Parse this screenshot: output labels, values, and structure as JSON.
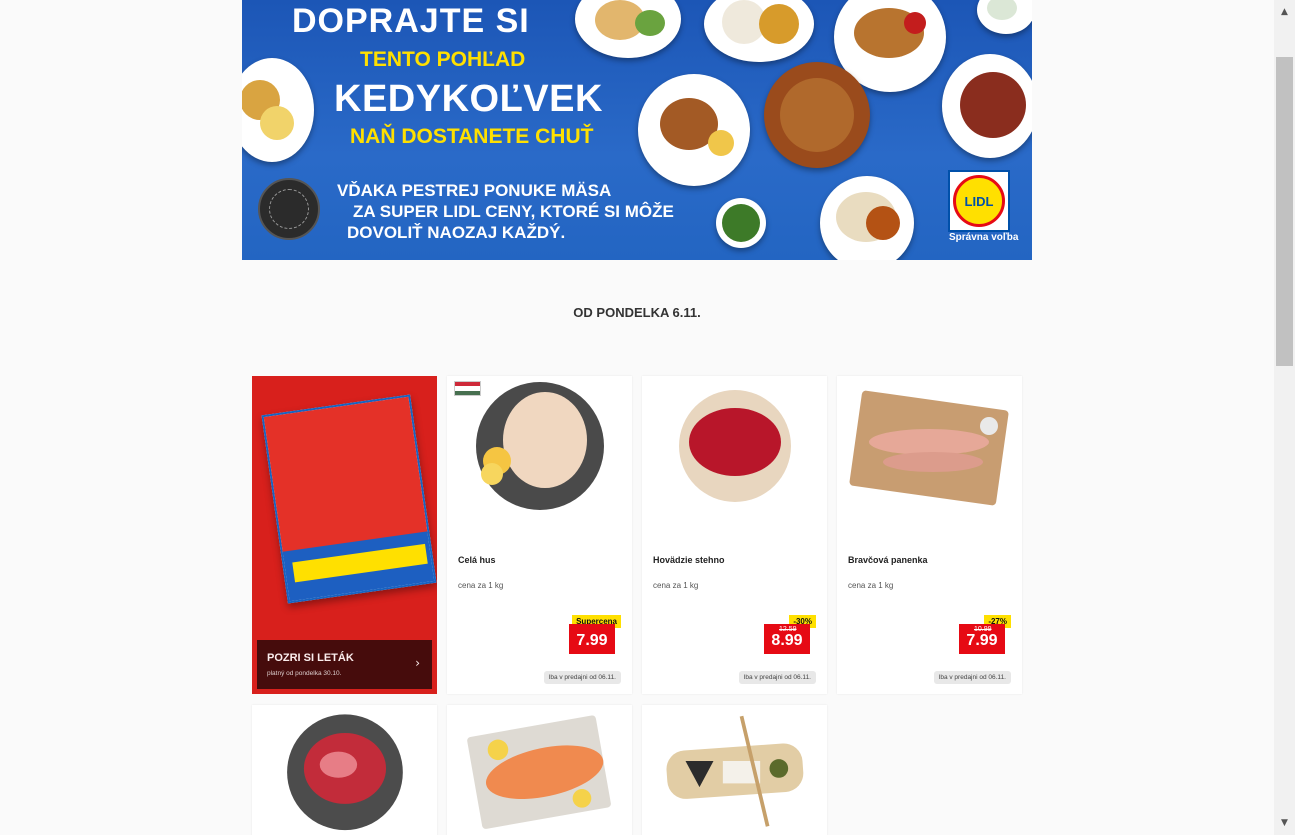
{
  "banner": {
    "line1": "DOPRAJTE SI",
    "line2": "TENTO POHĽAD",
    "line3": "KEDYKOĽVEK",
    "line4": "NAŇ DOSTANETE CHUŤ",
    "body": [
      "VĎAKA PESTREJ PONUKE MÄSA",
      "ZA SUPER LIDL CENY, KTORÉ SI MÔŽE",
      "DOVOLIŤ NAOZAJ KAŽDÝ."
    ],
    "logo_text": "LIDL",
    "logo_tagline": "Správna voľba",
    "colors": {
      "blue": "#1c56b6",
      "yellow": "#ffe000",
      "red": "#e60a14"
    }
  },
  "section": {
    "heading": "OD PONDELKA 6.11."
  },
  "leaflet": {
    "title": "POZRI SI LETÁK",
    "subtitle": "platný od pondelka 30.10.",
    "chevron": "›"
  },
  "products": [
    {
      "name": "Celá hus",
      "unit": "cena za 1 kg",
      "tag": "Supercena",
      "old_price": "",
      "price": "7.99",
      "availability": "Iba v predajni od 06.11.",
      "flag": "hungary"
    },
    {
      "name": "Hovädzie stehno",
      "unit": "cena za 1 kg",
      "tag": "-30%",
      "old_price": "12.59",
      "price": "8.99",
      "availability": "Iba v predajni od 06.11."
    },
    {
      "name": "Bravčová panenka",
      "unit": "cena za 1 kg",
      "tag": "-27%",
      "old_price": "10.99",
      "price": "7.99",
      "availability": "Iba v predajni od 06.11."
    }
  ],
  "scrollbar": {
    "up_icon": "▲",
    "down_icon": "▼"
  }
}
